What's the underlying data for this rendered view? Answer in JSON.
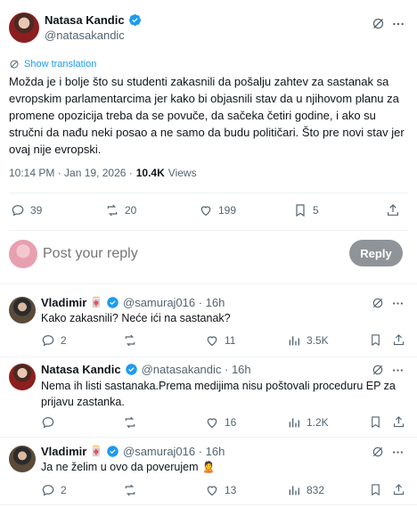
{
  "main_post": {
    "author_name": "Natasa Kandic",
    "author_handle": "@natasakandic",
    "show_translation": "Show translation",
    "text": "Možda je i bolje što su studenti zakasnili da pošalju zahtev za sastanak sa evropskim parlamentarcima jer kako bi objasnili stav da u njihovom planu za promene opozicija treba da se povuče, da sačeka četiri godine, i ako su stručni da nađu neki posao a ne samo da budu političari. Što pre novi stav jer ovaj  nije evropski.",
    "timestamp": "10:14 PM · Jan 19, 2026 ·",
    "views_count": "10.4K",
    "views_label": "Views",
    "replies": "39",
    "reposts": "20",
    "likes": "199",
    "bookmarks": "5"
  },
  "composer": {
    "placeholder": "Post your reply",
    "button_label": "Reply"
  },
  "replies": [
    {
      "name": "Vladimir",
      "handle": "@samuraj016 · 16h",
      "text": "Kako zakasnili? Neće ići na sastanak?",
      "replies": "2",
      "reposts": "",
      "likes": "11",
      "views": "3.5K"
    },
    {
      "name": "Natasa Kandic",
      "handle": "@natasakandic · 16h",
      "text": "Nema ih listi sastanaka.Prema medijima nisu poštovali proceduru EP za prijavu zastanka.",
      "replies": "",
      "reposts": "",
      "likes": "16",
      "views": "1.2K"
    },
    {
      "name": "Vladimir",
      "handle": "@samuraj016 · 16h",
      "text": "Ja ne želim u ovo da poverujem",
      "replies": "2",
      "reposts": "",
      "likes": "13",
      "views": "832"
    }
  ],
  "colors": {
    "verified": "#1d9bf0",
    "text": "#0f1419",
    "secondary": "#536471",
    "reply_button": "#8f9499",
    "link": "#1d9bf0"
  },
  "icons": [
    "verified-icon",
    "grok-icon",
    "more-icon",
    "translate-icon",
    "reply-icon",
    "repost-icon",
    "like-icon",
    "views-icon",
    "bookmark-icon",
    "share-icon",
    "emoji-icon"
  ]
}
